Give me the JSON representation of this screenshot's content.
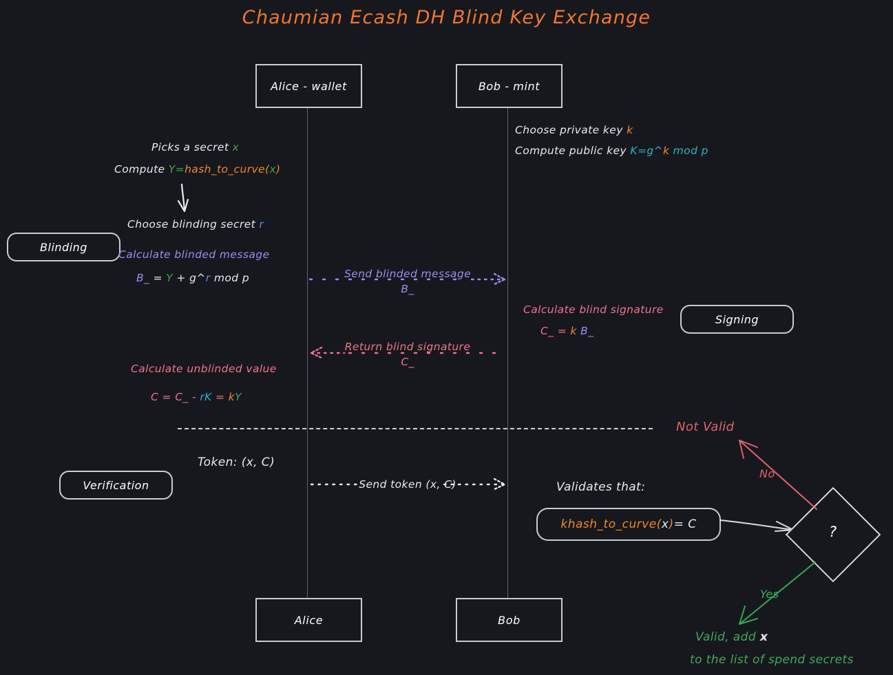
{
  "title": "Chaumian Ecash DH Blind Key Exchange",
  "colors": {
    "background": "#16181d",
    "title": "#f2762e",
    "stroke": "#c9ccd1",
    "lifeline": "#60646b",
    "white": "#e9eaec",
    "orange": "#f0882f",
    "green": "#35a853",
    "cyan": "#31b1c4",
    "blue": "#5b8ef0",
    "purple": "#9b8cf4",
    "pink": "#f4718f",
    "red": "#e0616f"
  },
  "actors": {
    "alice_top": "Alice - wallet",
    "bob_top": "Bob - mint",
    "alice_bottom": "Alice",
    "bob_bottom": "Bob"
  },
  "sections": {
    "blinding": "Blinding",
    "signing": "Signing",
    "verification": "Verification"
  },
  "alice": {
    "picks_prefix": "Picks a secret ",
    "picks_secret": "x",
    "compute_prefix": "Compute ",
    "compute_Y": "Y",
    "compute_eq": "=",
    "compute_fn": "hash_to_curve(",
    "compute_arg": "x",
    "compute_close": ")",
    "choose_blinding_prefix": "Choose blinding secret ",
    "choose_blinding_r": "r",
    "calc_blinded_label": "Calculate blinded message",
    "blinded_B": "B_",
    "blinded_eq": " = ",
    "blinded_Y": "Y",
    "blinded_plus": " + g^",
    "blinded_r": "r",
    "blinded_mod": " mod p",
    "calc_unblinded_label": "Calculate unblinded value",
    "unblinded_C": "C",
    "unblinded_eq1": " = ",
    "unblinded_Cbar": "C_",
    "unblinded_minus": " - ",
    "unblinded_r": "r",
    "unblinded_K": "K",
    "unblinded_eq2": " = ",
    "unblinded_k": "k",
    "unblinded_Y": "Y",
    "token_label": "Token: (x, C)"
  },
  "bob": {
    "choose_private_prefix": "Choose private key ",
    "choose_private_k": "k",
    "compute_public_prefix": "Compute public key ",
    "compute_public_K": "K=g^",
    "compute_public_k": "k",
    "compute_public_mod": " mod p",
    "calc_blind_sig_label": "Calculate blind signature",
    "sig_C": "C_",
    "sig_eq": " = ",
    "sig_k": "k",
    "sig_space": " ",
    "sig_B": "B_",
    "validates_label": "Validates that:",
    "validate_k": "k",
    "validate_fn": " hash_to_curve(",
    "validate_x": "x",
    "validate_close": ")",
    "validate_eq": " = C"
  },
  "messages": {
    "send_blinded_line1": "Send blinded message",
    "send_blinded_line2": "B_",
    "return_sig_line1": "Return blind signature",
    "return_sig_line2": "C_",
    "send_token": "Send token (x, C)"
  },
  "decision": {
    "mark": "?",
    "no_label": "No",
    "yes_label": "Yes",
    "not_valid": "Not Valid",
    "valid_line1_prefix": "Valid, add ",
    "valid_line1_x": "x",
    "valid_line2": "to the list of spend secrets"
  },
  "icons": {
    "down_arrow": "down-arrow-icon",
    "dotted_arrow_right": "dotted-arrow-right-icon",
    "dotted_arrow_left": "dotted-arrow-left-icon",
    "solid_arrow_right": "solid-arrow-right-icon",
    "decision_diamond": "decision-diamond-icon"
  }
}
